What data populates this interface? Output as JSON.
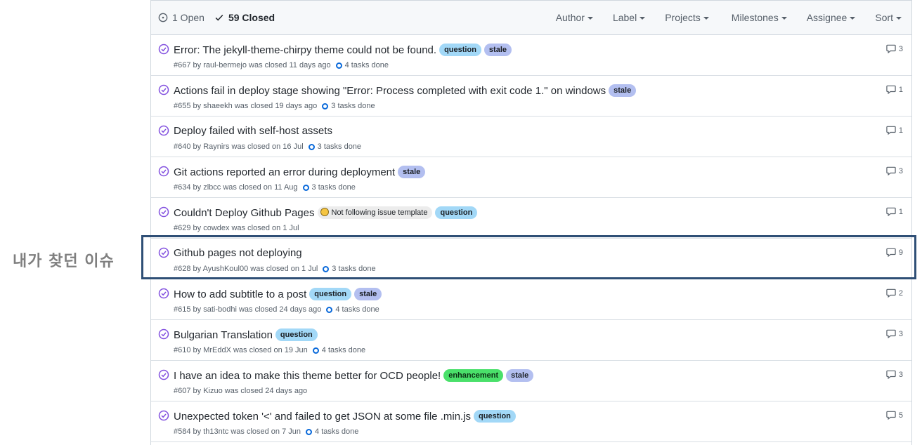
{
  "annotation": {
    "label": "내가 찾던 이슈"
  },
  "header": {
    "open_label": "1 Open",
    "closed_label": "59 Closed",
    "filters": [
      "Author",
      "Label",
      "Projects",
      "Milestones",
      "Assignee",
      "Sort"
    ]
  },
  "issues": [
    {
      "title": "Error: The jekyll-theme-chirpy theme could not be found.",
      "labels": [
        "question",
        "stale"
      ],
      "meta": "#667 by raul-bermejo was closed 11 days ago",
      "tasks": "4 tasks done",
      "comments": "3"
    },
    {
      "title": "Actions fail in deploy stage showing \"Error: Process completed with exit code 1.\" on windows",
      "labels": [
        "stale"
      ],
      "meta": "#655 by shaeekh was closed 19 days ago",
      "tasks": "3 tasks done",
      "comments": "1"
    },
    {
      "title": "Deploy failed with self-host assets",
      "labels": [],
      "meta": "#640 by Raynirs was closed on 16 Jul",
      "tasks": "3 tasks done",
      "comments": "1"
    },
    {
      "title": "Git actions reported an error during deployment",
      "labels": [
        "stale"
      ],
      "meta": "#634 by zlbcc was closed on 11 Aug",
      "tasks": "3 tasks done",
      "comments": "3"
    },
    {
      "title": "Couldn't Deploy Github Pages",
      "labels": [
        "Not following issue template",
        "question"
      ],
      "meta": "#629 by cowdex was closed on 1 Jul",
      "tasks": "",
      "comments": "1"
    },
    {
      "title": "Github pages not deploying",
      "labels": [],
      "meta": "#628 by AyushKoul00 was closed on 1 Jul",
      "tasks": "3 tasks done",
      "comments": "9"
    },
    {
      "title": "How to add subtitle to a post",
      "labels": [
        "question",
        "stale"
      ],
      "meta": "#615 by sati-bodhi was closed 24 days ago",
      "tasks": "4 tasks done",
      "comments": "2"
    },
    {
      "title": "Bulgarian Translation",
      "labels": [
        "question"
      ],
      "meta": "#610 by MrEddX was closed on 19 Jun",
      "tasks": "4 tasks done",
      "comments": "3"
    },
    {
      "title": "I have an idea to make this theme better for OCD people!",
      "labels": [
        "enhancement",
        "stale"
      ],
      "meta": "#607 by Kizuo was closed 24 days ago",
      "tasks": "",
      "comments": "3"
    },
    {
      "title": "Unexpected token '<' and failed to get JSON at some file .min.js",
      "labels": [
        "question"
      ],
      "meta": "#584 by th13ntc was closed on 7 Jun",
      "tasks": "4 tasks done",
      "comments": "5"
    }
  ],
  "colors": {
    "closed_icon": "#8250df",
    "task_ring": "#0969da",
    "question": "#a2d8f7",
    "stale": "#b3bff0",
    "enhancement": "#4ae06a",
    "annotation_box": "#2f4f76"
  }
}
